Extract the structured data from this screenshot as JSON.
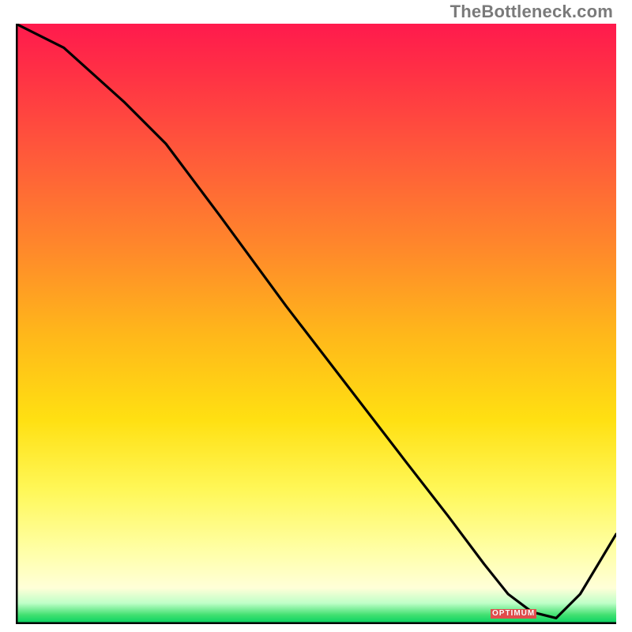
{
  "watermark": "TheBottleneck.com",
  "marker_label": "OPTIMUM",
  "chart_data": {
    "type": "line",
    "title": "",
    "xlabel": "",
    "ylabel": "",
    "xlim": [
      0,
      100
    ],
    "ylim": [
      0,
      100
    ],
    "x": [
      0,
      8,
      18,
      25,
      34,
      45,
      55,
      65,
      72,
      78,
      82,
      86,
      90,
      94,
      100
    ],
    "values": [
      100,
      96,
      87,
      80,
      68,
      53,
      40,
      27,
      18,
      10,
      5,
      2,
      1,
      5,
      15
    ],
    "optimum_x": 85,
    "gradient_stops": [
      {
        "pos": 0,
        "color": "#ff1a4d"
      },
      {
        "pos": 0.22,
        "color": "#ff5a3a"
      },
      {
        "pos": 0.52,
        "color": "#ffb81a"
      },
      {
        "pos": 0.78,
        "color": "#fff85a"
      },
      {
        "pos": 0.96,
        "color": "#bfffc8"
      },
      {
        "pos": 1.0,
        "color": "#00d060"
      }
    ]
  }
}
